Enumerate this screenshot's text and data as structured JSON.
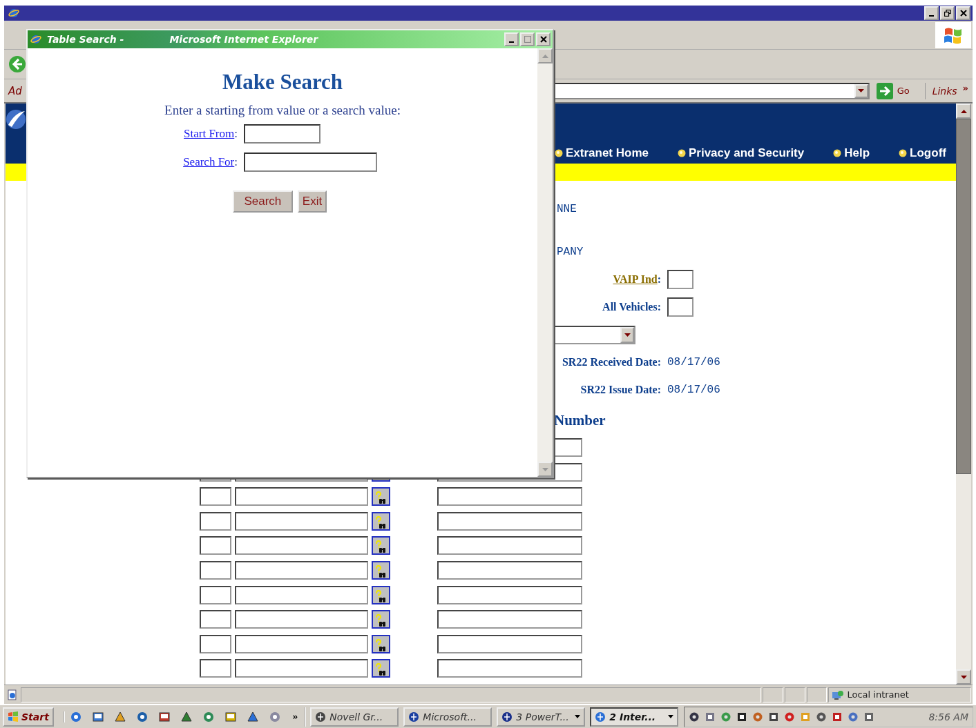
{
  "toolbar": {
    "address_label": "Ad",
    "go": "Go",
    "links": "Links",
    "more": "»"
  },
  "site": {
    "nav": [
      {
        "label": "Extranet Home"
      },
      {
        "label": "Privacy and Security"
      },
      {
        "label": "Help"
      },
      {
        "label": "Logoff"
      }
    ],
    "form": [
      {
        "kind": "value",
        "value": "NNE"
      },
      {
        "kind": "value",
        "value": "PANY"
      },
      {
        "kind": "input",
        "label": "VAIP Ind",
        "punct": ":",
        "link": true
      },
      {
        "kind": "input",
        "label": "All Vehicles",
        "punct": ":",
        "link": false
      },
      {
        "kind": "select"
      },
      {
        "kind": "date",
        "label": "SR22 Received Date",
        "punct": ":",
        "value": "08/17/06"
      },
      {
        "kind": "date",
        "label": "SR22 Issue Date",
        "punct": ":",
        "value": "08/17/06"
      },
      {
        "kind": "heading",
        "label": "Number"
      }
    ],
    "vehicle_rows": [
      {
        "kind": "value-only"
      },
      {
        "kind": "lookup"
      },
      {
        "kind": "lookup"
      },
      {
        "kind": "lookup"
      },
      {
        "kind": "lookup"
      },
      {
        "kind": "lookup"
      },
      {
        "kind": "lookup"
      },
      {
        "kind": "lookup"
      },
      {
        "kind": "lookup"
      },
      {
        "kind": "lookup"
      }
    ]
  },
  "popup": {
    "title": "Table Search -",
    "title_app": "Microsoft Internet Explorer",
    "heading": "Make Search",
    "prompt": "Enter a starting from value or a search value:",
    "fields": [
      {
        "label": "Start From",
        "punct": ":"
      },
      {
        "label": "Search For",
        "punct": ":"
      }
    ],
    "buttons": [
      "Search",
      "Exit"
    ]
  },
  "status_bar": {
    "zone": "Local intranet"
  },
  "taskbar": {
    "start": "Start",
    "more": "»",
    "tasks": [
      {
        "label": "Novell Gr...",
        "selected": false,
        "grouped": false
      },
      {
        "label": "Microsoft...",
        "selected": false,
        "grouped": false
      },
      {
        "label": "3 PowerT...",
        "selected": false,
        "grouped": true
      },
      {
        "label": "2 Inter...",
        "selected": true,
        "grouped": true
      }
    ],
    "clock": "8:56 AM"
  }
}
